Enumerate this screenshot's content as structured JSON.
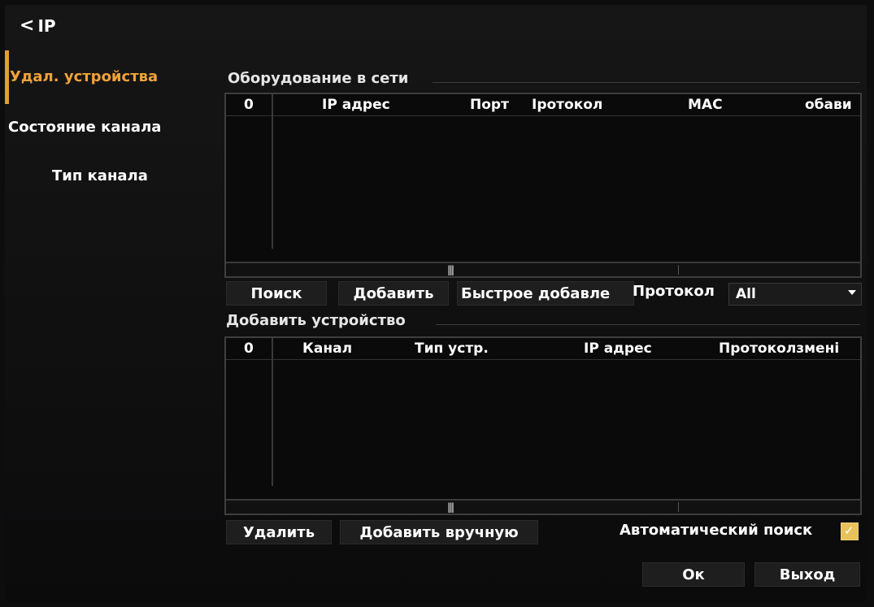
{
  "header": {
    "back_label": "IP"
  },
  "sidebar": {
    "items": [
      {
        "label": "Удал. устройства",
        "active": true
      },
      {
        "label": "Состояние канала",
        "active": false
      },
      {
        "label": "Тип канала",
        "active": false
      }
    ]
  },
  "network_devices": {
    "title": "Оборудование в сети",
    "columns": [
      "0",
      "IP адрес",
      "Порт",
      "Іротокол",
      "MAC",
      "обави"
    ],
    "search_button": "Поиск",
    "add_button": "Добавить",
    "quick_add_button": "Быстрое добавле",
    "protocol_label": "Протокол",
    "protocol_value": "All"
  },
  "added_devices": {
    "title": "Добавить устройство",
    "columns": [
      "0",
      "Канал",
      "Тип устр.",
      "IP адрес",
      "Протоколзмені"
    ],
    "delete_button": "Удалить",
    "manual_add_button": "Добавить вручную",
    "auto_search_label": "Автоматический поиск",
    "auto_search_checked": true
  },
  "footer": {
    "ok_button": "Ок",
    "exit_button": "Выход"
  },
  "colors": {
    "accent": "#f0a23a",
    "checkbox": "#e8c15a"
  }
}
